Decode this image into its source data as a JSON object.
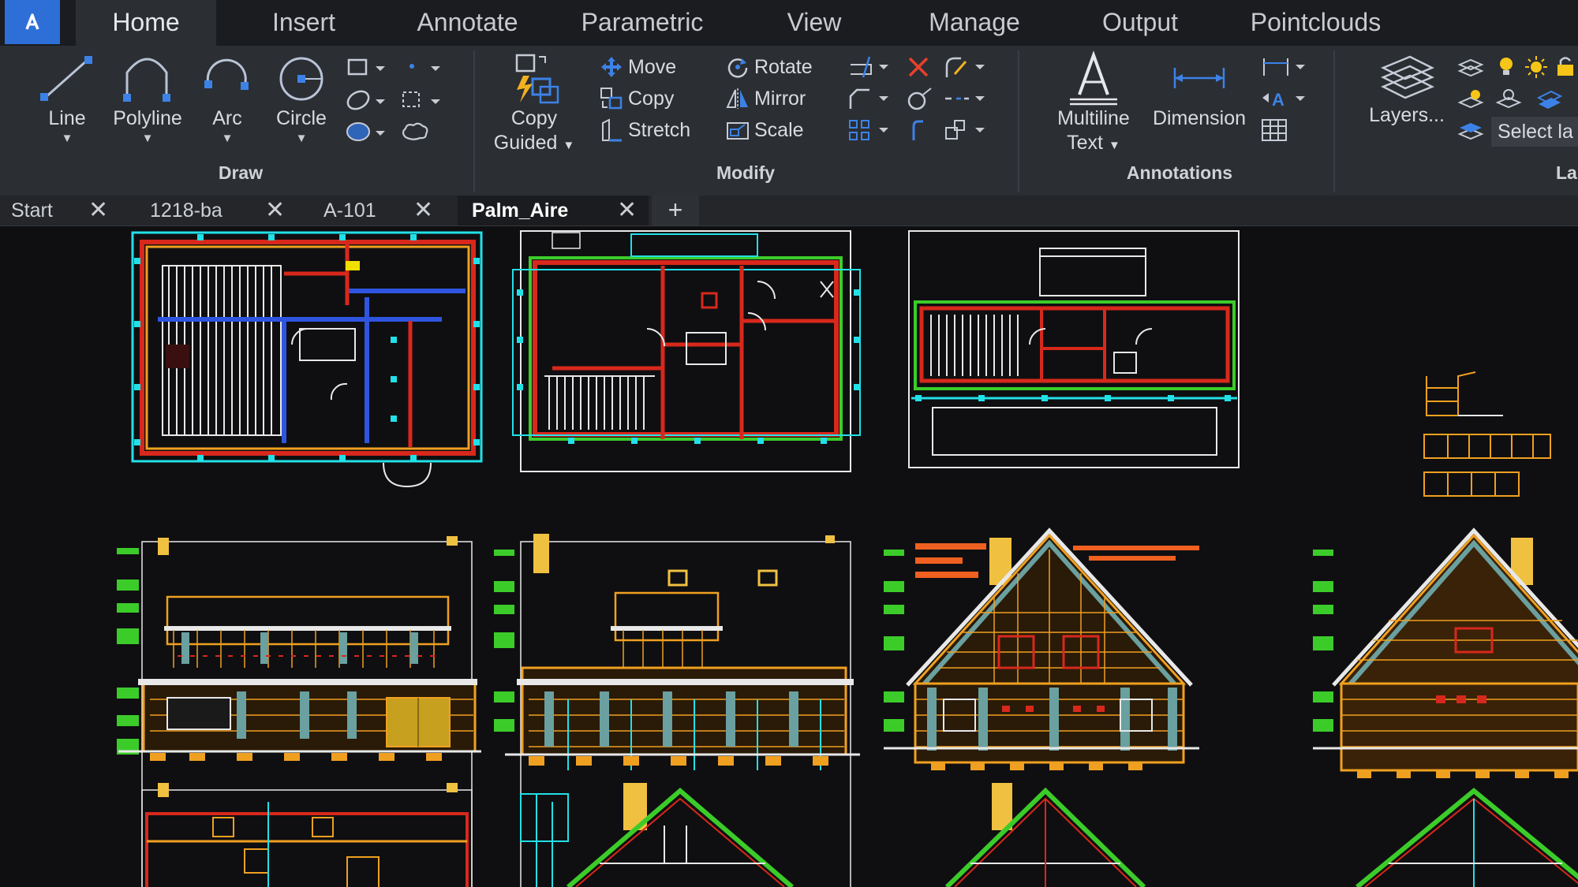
{
  "menu": {
    "tabs": [
      {
        "label": "Home",
        "active": true
      },
      {
        "label": "Insert"
      },
      {
        "label": "Annotate"
      },
      {
        "label": "Parametric"
      },
      {
        "label": "View"
      },
      {
        "label": "Manage"
      },
      {
        "label": "Output"
      },
      {
        "label": "Pointclouds"
      }
    ]
  },
  "ribbon": {
    "draw": {
      "group_label": "Draw",
      "line": "Line",
      "polyline": "Polyline",
      "arc": "Arc",
      "circle": "Circle"
    },
    "modify": {
      "group_label": "Modify",
      "copy_guided_1": "Copy",
      "copy_guided_2": "Guided",
      "move": "Move",
      "copy": "Copy",
      "stretch": "Stretch",
      "rotate": "Rotate",
      "mirror": "Mirror",
      "scale": "Scale"
    },
    "annotations": {
      "group_label": "Annotations",
      "multiline_text_1": "Multiline",
      "multiline_text_2": "Text",
      "dimension": "Dimension"
    },
    "layers": {
      "layers": "Layers...",
      "select_layer": "Select la",
      "group_label_partial": "La"
    }
  },
  "doc_tabs": [
    {
      "label": "Start"
    },
    {
      "label": "1218-ba"
    },
    {
      "label": "A-101"
    },
    {
      "label": "Palm_Aire",
      "active": true
    }
  ],
  "colors": {
    "accent_blue": "#2d6fd6",
    "ribbon_bg": "#2b2e33",
    "canvas_bg": "#0f0f11",
    "cad_orange": "#f0a020",
    "cad_cyan": "#22e0e8",
    "cad_red": "#d8281c",
    "cad_green": "#3ccc2a",
    "cad_white": "#e8e8e8"
  }
}
